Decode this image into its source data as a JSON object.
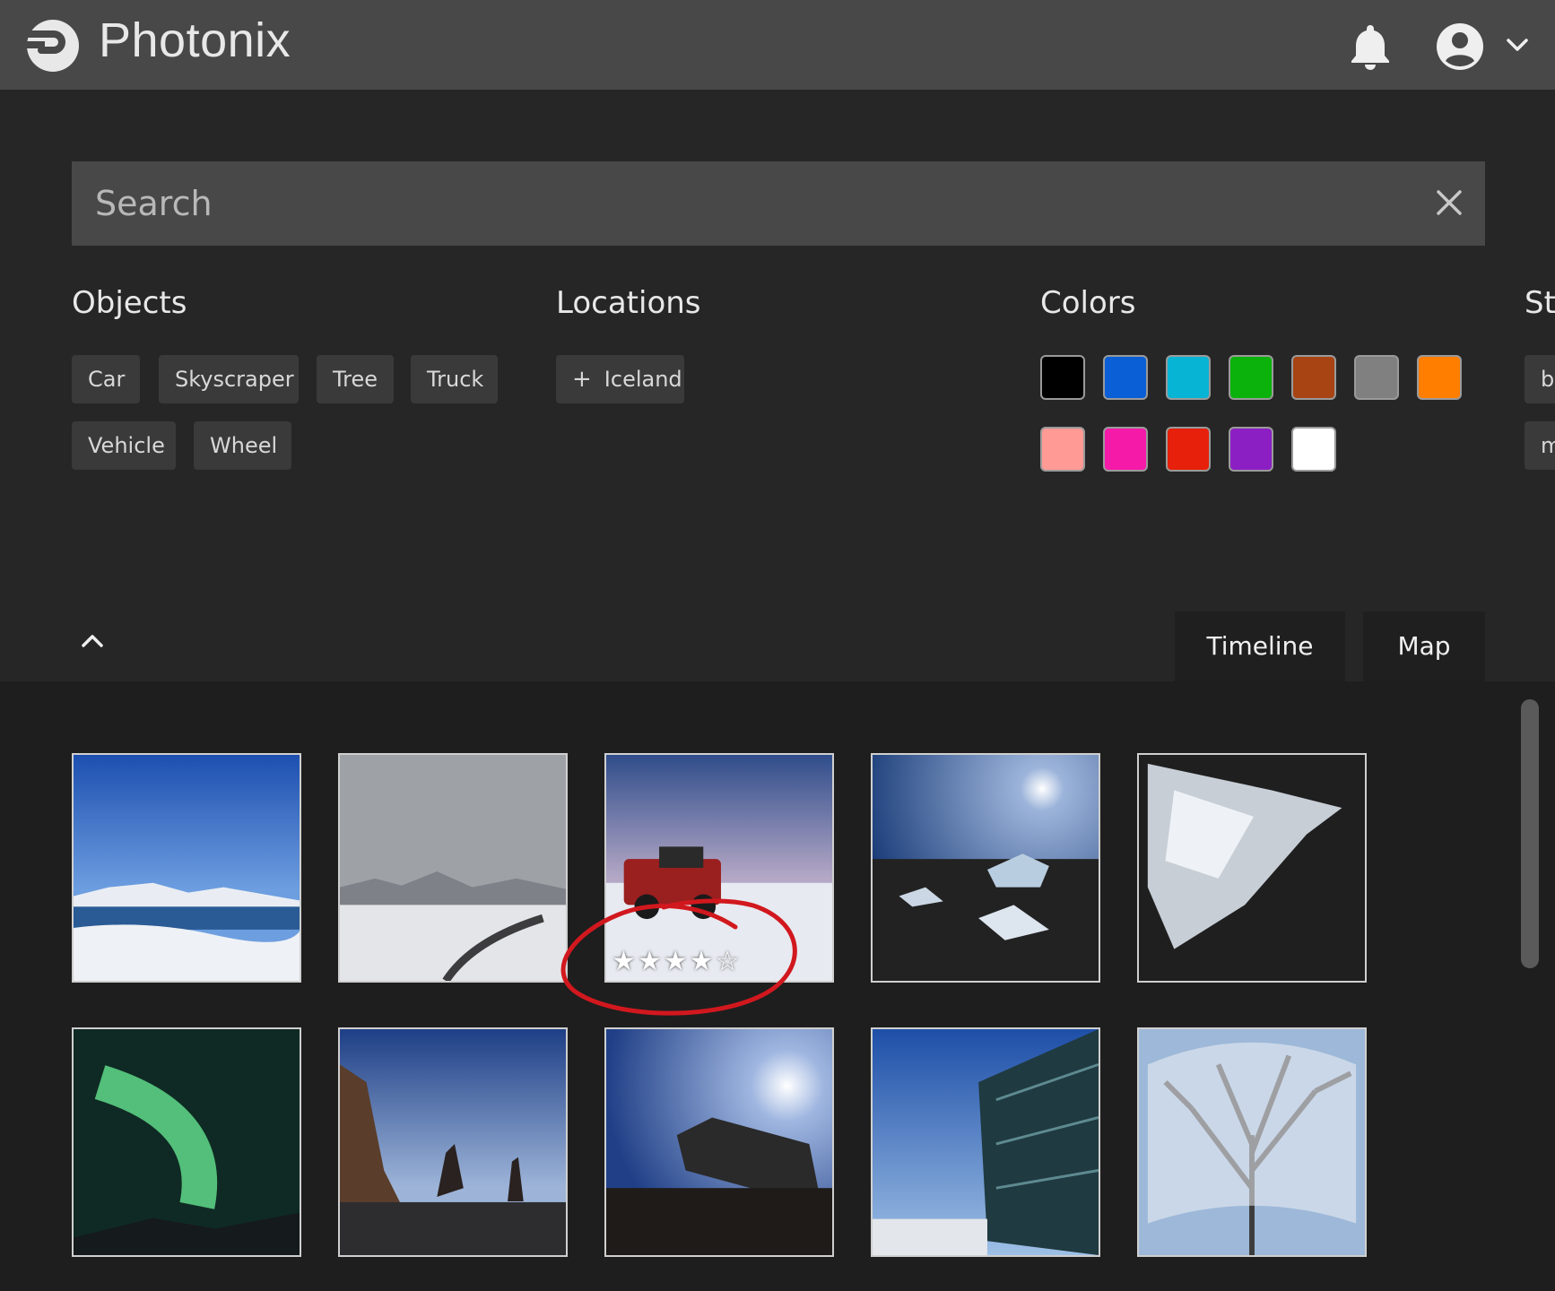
{
  "app": {
    "title": "Photonix"
  },
  "header": {
    "icons": [
      "photonix-logo-icon",
      "bell-icon",
      "account-circle-icon",
      "chevron-down-icon"
    ]
  },
  "search": {
    "placeholder": "Search",
    "value": ""
  },
  "filters": {
    "objects": {
      "title": "Objects",
      "tags": [
        "Car",
        "Skyscraper",
        "Tree",
        "Truck",
        "Vehicle",
        "Wheel"
      ]
    },
    "locations": {
      "title": "Locations",
      "tags": [
        "Iceland"
      ]
    },
    "colors": {
      "title": "Colors",
      "swatches": [
        "#000000",
        "#0a5fd6",
        "#08b4d4",
        "#0bb20b",
        "#a84414",
        "#808080",
        "#ff7e00",
        "#ff9a94",
        "#f51aa8",
        "#e6200a",
        "#8c1fc4",
        "#ffffff"
      ]
    },
    "styles_partial": {
      "title": "St",
      "chips": [
        "b",
        "m"
      ]
    }
  },
  "view_tabs": [
    "Timeline",
    "Map"
  ],
  "gallery": {
    "photos": [
      {
        "subject": "snowy fjord under blue sky"
      },
      {
        "subject": "snow-covered road and mountains"
      },
      {
        "subject": "red truck on snowy plain",
        "rating": "★★★★☆"
      },
      {
        "subject": "ice on black sand beach with sun"
      },
      {
        "subject": "clear ice chunk on black sand"
      },
      {
        "subject": "green aurora borealis"
      },
      {
        "subject": "sea stacks on black beach"
      },
      {
        "subject": "plane wreck silhouette"
      },
      {
        "subject": "glass building facade"
      },
      {
        "subject": "snow-covered tree branches"
      }
    ]
  }
}
